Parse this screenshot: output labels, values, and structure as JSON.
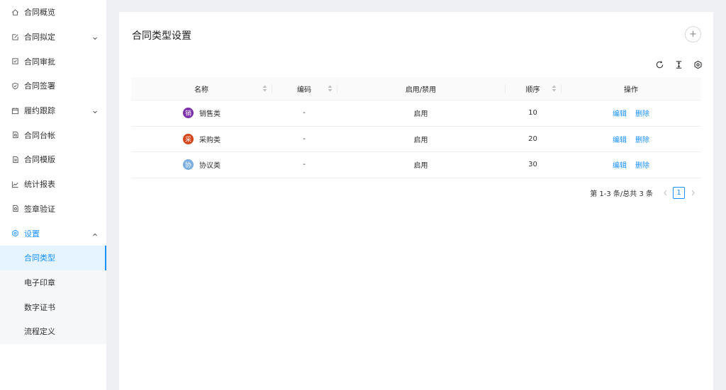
{
  "sidebar": {
    "items": [
      {
        "label": "合同概览",
        "icon": "home-icon"
      },
      {
        "label": "合同拟定",
        "icon": "edit-icon",
        "expandable": true
      },
      {
        "label": "合同审批",
        "icon": "check-square-icon"
      },
      {
        "label": "合同签署",
        "icon": "shield-check-icon"
      },
      {
        "label": "履约跟踪",
        "icon": "calendar-icon",
        "expandable": true
      },
      {
        "label": "合同台帐",
        "icon": "file-search-icon"
      },
      {
        "label": "合同模版",
        "icon": "file-text-icon"
      },
      {
        "label": "统计报表",
        "icon": "line-chart-icon"
      },
      {
        "label": "签章验证",
        "icon": "file-verify-icon"
      },
      {
        "label": "设置",
        "icon": "settings-icon",
        "expanded": true
      }
    ],
    "submenu": [
      {
        "label": "合同类型",
        "selected": true
      },
      {
        "label": "电子印章"
      },
      {
        "label": "数字证书"
      },
      {
        "label": "流程定义"
      }
    ]
  },
  "page": {
    "title": "合同类型设置",
    "add_button": "+"
  },
  "toolbar": [
    "refresh-icon",
    "column-height-icon",
    "settings-icon"
  ],
  "table": {
    "columns": [
      "名称",
      "编码",
      "启用/禁用",
      "顺序",
      "操作"
    ],
    "rows": [
      {
        "avatar": "销",
        "avatar_color": "#7b2fa8",
        "name": "销售类",
        "code": "-",
        "status": "启用",
        "order": "10",
        "edit": "编辑",
        "delete": "删除"
      },
      {
        "avatar": "采",
        "avatar_color": "#d4451a",
        "name": "采购类",
        "code": "-",
        "status": "启用",
        "order": "20",
        "edit": "编辑",
        "delete": "删除"
      },
      {
        "avatar": "协",
        "avatar_color": "#7aaee0",
        "name": "协议类",
        "code": "-",
        "status": "启用",
        "order": "30",
        "edit": "编辑",
        "delete": "删除"
      }
    ]
  },
  "pagination": {
    "summary": "第 1-3 条/总共 3 条",
    "current": "1"
  },
  "colors": {
    "accent": "#1890ff"
  }
}
